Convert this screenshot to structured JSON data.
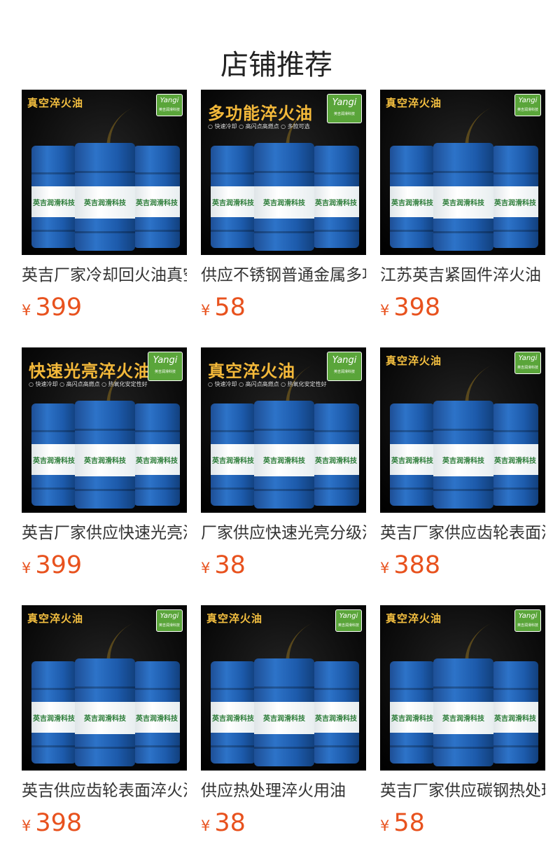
{
  "page": {
    "title": "店铺推荐"
  },
  "colors": {
    "price": "#e8521e",
    "drum_blue": "#2d73c8",
    "logo_green": "#5aa53a",
    "banner_gold": "#f4b93a"
  },
  "icons": {
    "brand_logo": "yingji-logo-icon"
  },
  "products": [
    {
      "name": "英吉厂家冷却回火油真空淬火油",
      "currency": "¥",
      "price": "399",
      "image": {
        "banner": "真空淬火油",
        "features": "",
        "logo_text": "Yangi",
        "logo_sub": "英吉润滑科技",
        "drum_label": "英吉润滑科技"
      }
    },
    {
      "name": "供应不锈钢普通金属多功能淬火油",
      "currency": "¥",
      "price": "58",
      "image": {
        "banner": "多功能淬火油",
        "features": "○ 快速冷却  ○ 高闪点高燃点  ○ 多款可选",
        "logo_text": "Yangi",
        "logo_sub": "英吉润滑科技",
        "drum_label": "英吉润滑科技"
      }
    },
    {
      "name": "江苏英吉紧固件淬火油",
      "currency": "¥",
      "price": "398",
      "image": {
        "banner": "真空淬火油",
        "features": "",
        "logo_text": "Yangi",
        "logo_sub": "英吉润滑科技",
        "drum_label": "英吉润滑科技"
      }
    },
    {
      "name": "英吉厂家供应快速光亮淬火油",
      "currency": "¥",
      "price": "399",
      "image": {
        "banner": "快速光亮淬火油",
        "features": "○ 快速冷却  ○ 高闪点高燃点  ○ 热氧化安定性好",
        "logo_text": "Yangi",
        "logo_sub": "英吉润滑科技",
        "drum_label": "英吉润滑科技"
      }
    },
    {
      "name": "厂家供应快速光亮分级淬火油",
      "currency": "¥",
      "price": "38",
      "image": {
        "banner": "真空淬火油",
        "features": "○ 快速冷却  ○ 高闪点高燃点  ○ 热氧化安定性好",
        "logo_text": "Yangi",
        "logo_sub": "英吉润滑科技",
        "drum_label": "英吉润滑科技"
      }
    },
    {
      "name": "英吉厂家供应齿轮表面淬火油",
      "currency": "¥",
      "price": "388",
      "image": {
        "banner": "真空淬火油",
        "features": "",
        "logo_text": "Yangi",
        "logo_sub": "英吉润滑科技",
        "drum_label": "英吉润滑科技"
      }
    },
    {
      "name": "英吉供应齿轮表面淬火油",
      "currency": "¥",
      "price": "398",
      "image": {
        "banner": "真空淬火油",
        "features": "",
        "logo_text": "Yangi",
        "logo_sub": "英吉润滑科技",
        "drum_label": "英吉润滑科技"
      }
    },
    {
      "name": "供应热处理淬火用油",
      "currency": "¥",
      "price": "38",
      "image": {
        "banner": "真空淬火油",
        "features": "",
        "logo_text": "Yangi",
        "logo_sub": "英吉润滑科技",
        "drum_label": "英吉润滑科技"
      }
    },
    {
      "name": "英吉厂家供应碳钢热处理淬火油",
      "currency": "¥",
      "price": "58",
      "image": {
        "banner": "真空淬火油",
        "features": "",
        "logo_text": "Yangi",
        "logo_sub": "英吉润滑科技",
        "drum_label": "英吉润滑科技"
      }
    }
  ]
}
